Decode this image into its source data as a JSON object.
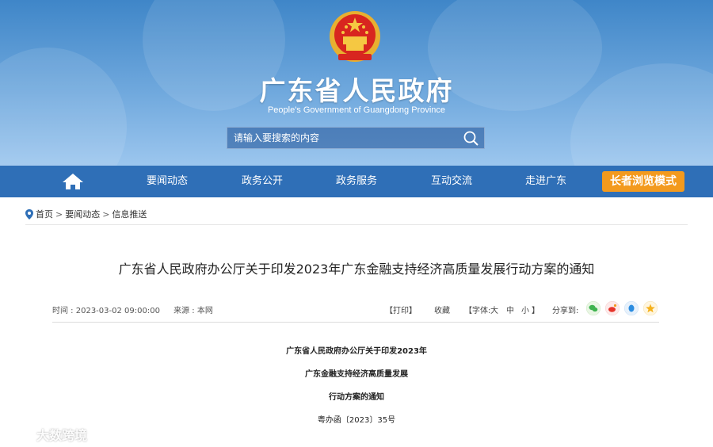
{
  "header": {
    "title": "广东省人民政府",
    "subtitle": "People's Government of Guangdong Province",
    "search_placeholder": "请输入要搜索的内容"
  },
  "nav": {
    "home_icon": "home-icon",
    "items": [
      "要闻动态",
      "政务公开",
      "政务服务",
      "互动交流",
      "走进广东"
    ],
    "elder_mode": "长者浏览模式"
  },
  "breadcrumb": [
    "首页",
    "要闻动态",
    "信息推送"
  ],
  "article": {
    "title": "广东省人民政府办公厅关于印发2023年广东金融支持经济高质量发展行动方案的通知",
    "time": "时间 : 2023-03-02 09:00:00",
    "source": "来源 : 本网",
    "print": "【打印】",
    "favorite": "收藏",
    "font_prefix": "【字体:",
    "font_large": "大",
    "font_medium": "中",
    "font_small": "小",
    "font_suffix": "】",
    "share_label": "分享到:",
    "share_icons": [
      "wechat-icon",
      "weibo-icon",
      "qq-icon",
      "qzone-icon"
    ],
    "body_lines": [
      "广东省人民政府办公厅关于印发2023年",
      "广东金融支持经济高质量发展",
      "行动方案的通知",
      "粤办函〔2023〕35号"
    ]
  },
  "watermark": "大数跨境",
  "colors": {
    "nav": "#2f6fb7",
    "elder": "#f39a1e",
    "header_top": "#3f86c8"
  }
}
